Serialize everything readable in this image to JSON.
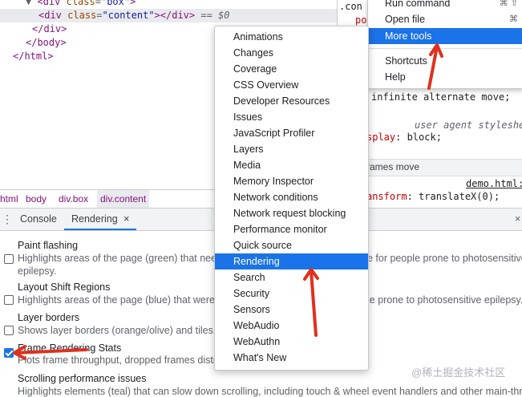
{
  "elements": {
    "lines": [
      {
        "indent": 2,
        "parts": [
          [
            "tri",
            "▼ "
          ],
          [
            "punct",
            "<"
          ],
          [
            "tag",
            "div"
          ],
          [
            "sp",
            " "
          ],
          [
            "attr",
            "class"
          ],
          [
            "eq",
            "="
          ],
          [
            "val",
            "\"box\""
          ],
          [
            "punct",
            ">"
          ]
        ]
      },
      {
        "indent": 4,
        "parts": [
          [
            "punct",
            "<"
          ],
          [
            "tag",
            "div"
          ],
          [
            "sp",
            " "
          ],
          [
            "attr",
            "class"
          ],
          [
            "eq",
            "="
          ],
          [
            "val",
            "\"content\""
          ],
          [
            "punct",
            "></"
          ],
          [
            "tag",
            "div"
          ],
          [
            "punct",
            ">"
          ],
          [
            "eq",
            " == "
          ],
          [
            "dollar",
            "$0"
          ]
        ]
      },
      {
        "indent": 3,
        "parts": [
          [
            "punct",
            "</"
          ],
          [
            "tag",
            "div"
          ],
          [
            "punct",
            ">"
          ]
        ]
      },
      {
        "indent": 2,
        "parts": [
          [
            "punct",
            "</"
          ],
          [
            "tag",
            "body"
          ],
          [
            "punct",
            ">"
          ]
        ]
      },
      {
        "indent": 0,
        "parts": [
          [
            "punct",
            "</"
          ],
          [
            "tag",
            "html"
          ],
          [
            "punct",
            ">"
          ]
        ]
      }
    ]
  },
  "styles": {
    "top_selector": ".con",
    "top_prop": "po",
    "animation_value": "infinite alternate move;",
    "ua_label": "user agent styleshe",
    "display_prop": "splay",
    "display_value": "block;",
    "keyframes_label": "rames move",
    "source_link": "demo.html:",
    "transform_prop": "ansform",
    "transform_value": "translateX(0);"
  },
  "breadcrumb": [
    "html",
    "body",
    "div.box",
    "div.content"
  ],
  "drawer": {
    "menu_icon": "⋮",
    "tabs": [
      {
        "label": "Console",
        "active": false
      },
      {
        "label": "Rendering",
        "active": true,
        "close": "×"
      }
    ],
    "right_close": "×"
  },
  "rendering": {
    "options": [
      {
        "title": "Paint flashing",
        "desc": "Highlights areas of the page (green) that need",
        "desc_tail": "e for people prone to photosensitive",
        "desc2": "epilepsy.",
        "checked": false
      },
      {
        "title": "Layout Shift Regions",
        "desc": "Highlights areas of the page (blue) that were s",
        "desc_tail": "le prone to photosensitive epilepsy.",
        "checked": false
      },
      {
        "title": "Layer borders",
        "desc": "Shows layer borders (orange/olive) and tiles (c",
        "checked": false
      },
      {
        "title": "Frame Rendering Stats",
        "desc": "Plots frame throughput, dropped frames distri",
        "checked": true
      },
      {
        "title": "Scrolling performance issues",
        "desc": "Highlights elements (teal) that can slow down scrolling, including touch & wheel event handlers and other main-thread",
        "checked": false
      }
    ]
  },
  "main_menu": {
    "items": [
      {
        "label": "Run command",
        "shortcut": "⌘ ⇧"
      },
      {
        "label": "Open file",
        "shortcut": "⌘"
      },
      {
        "label": "More tools",
        "shortcut": "",
        "highlighted": true
      },
      {
        "label": "Shortcuts",
        "shortcut": ""
      },
      {
        "label": "Help",
        "shortcut": ""
      }
    ]
  },
  "submenu": {
    "items": [
      "Animations",
      "Changes",
      "Coverage",
      "CSS Overview",
      "Developer Resources",
      "Issues",
      "JavaScript Profiler",
      "Layers",
      "Media",
      "Memory Inspector",
      "Network conditions",
      "Network request blocking",
      "Performance monitor",
      "Quick source",
      "Rendering",
      "Search",
      "Security",
      "Sensors",
      "WebAudio",
      "WebAuthn",
      "What's New"
    ],
    "highlighted": "Rendering"
  },
  "annotation": {
    "arrow_color": "#e0301e"
  },
  "watermark": "@稀土掘金技术社区"
}
